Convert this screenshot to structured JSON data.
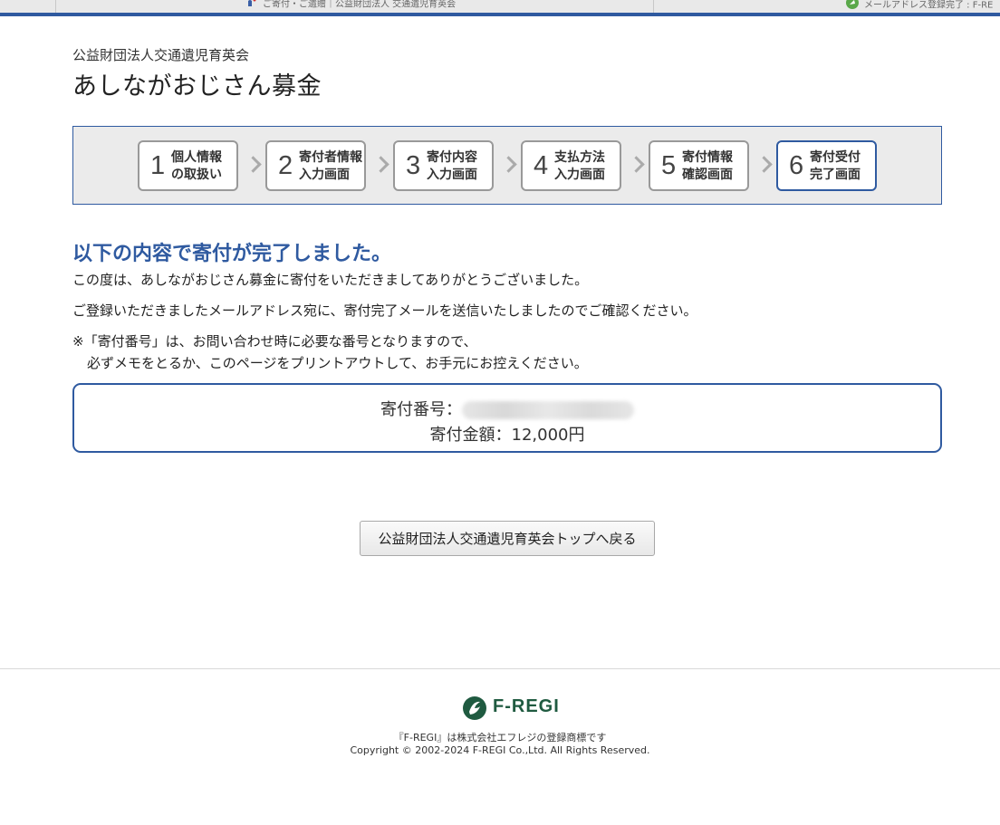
{
  "browser": {
    "tab1_title": "ご寄付・ご遺贈｜公益財団法人 交通遺児育英会",
    "tab2_title": "メールアドレス登録完了 : F-RE"
  },
  "header": {
    "org_name": "公益財団法人交通遺児育英会",
    "page_title": "あしながおじさん募金"
  },
  "steps": [
    {
      "num": "1",
      "line1": "個人情報",
      "line2": "の取扱い"
    },
    {
      "num": "2",
      "line1": "寄付者情報",
      "line2": "入力画面"
    },
    {
      "num": "3",
      "line1": "寄付内容",
      "line2": "入力画面"
    },
    {
      "num": "4",
      "line1": "支払方法",
      "line2": "入力画面"
    },
    {
      "num": "5",
      "line1": "寄付情報",
      "line2": "確認画面"
    },
    {
      "num": "6",
      "line1": "寄付受付",
      "line2": "完了画面"
    }
  ],
  "main": {
    "heading": "以下の内容で寄付が完了しました。",
    "para1": "この度は、あしながおじさん募金に寄付をいただきましてありがとうございました。",
    "para2": "ご登録いただきましたメールアドレス宛に、寄付完了メールを送信いたしましたのでご確認ください。",
    "para3": "※「寄付番号」は、お問い合わせ時に必要な番号となりますので、",
    "para4": "必ずメモをとるか、このページをプリントアウトして、お手元にお控えください。",
    "donation_number_label": "寄付番号：",
    "donation_amount_label": "寄付金額：12,000円"
  },
  "back_button_label": "公益財団法人交通遺児育英会トップへ戻る",
  "footer": {
    "logo_text": "F-REGI",
    "trademark": "『F-REGI』は株式会社エフレジの登録商標です",
    "copyright": "Copyright © 2002-2024 F-REGI Co.,Ltd. All Rights Reserved."
  },
  "colors": {
    "accent": "#2f5aa0",
    "logo_green": "#1f5a40"
  }
}
